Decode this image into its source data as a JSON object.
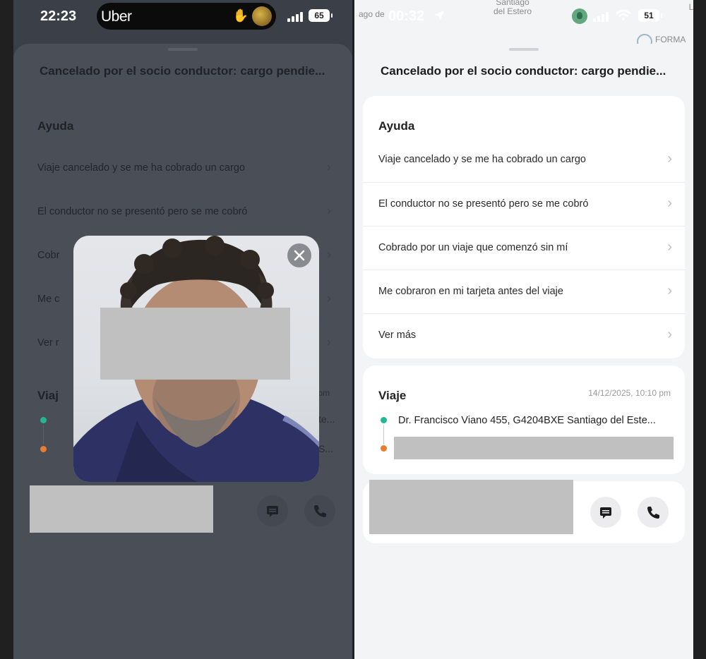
{
  "left_screen": {
    "status": {
      "time": "22:23",
      "battery": "65"
    },
    "live_activity": {
      "brand": "Uber",
      "hand_icon": "hand-icon",
      "thumb_icon": "map-thumb-icon"
    },
    "sheet_title": "Cancelado por el socio conductor: cargo pendie...",
    "help": {
      "heading": "Ayuda",
      "items": [
        "Viaje cancelado y se me ha cobrado un cargo",
        "El conductor no se presentó pero se me cobró",
        "Cobr",
        "Me c",
        "Ver r"
      ]
    },
    "trip": {
      "heading": "Viaj",
      "date": "0 pm",
      "pickup": "te...",
      "dropoff": "S..."
    },
    "photo_popup": {
      "close_icon": "close-icon"
    }
  },
  "right_screen": {
    "status": {
      "time": "00:32",
      "battery": "51"
    },
    "map_labels": {
      "top_center": "Santiago\ndel Estero",
      "top_left": "ago de",
      "top_right": "L",
      "right": "FORMA"
    },
    "sheet_title": "Cancelado por el socio conductor: cargo pendie...",
    "help": {
      "heading": "Ayuda",
      "items": [
        "Viaje cancelado y se me ha cobrado un cargo",
        "El conductor no se presentó pero se me cobró",
        "Cobrado por un viaje que comenzó sin mí",
        "Me cobraron en mi tarjeta antes del viaje",
        "Ver más"
      ]
    },
    "trip": {
      "heading": "Viaje",
      "date": "14/12/2025, 10:10 pm",
      "pickup": "Dr. Francisco Viano 455, G4204BXE Santiago del Este..."
    },
    "driver": {
      "message_icon": "message-icon",
      "phone_icon": "phone-icon"
    }
  },
  "colors": {
    "route_start": "#22b794",
    "route_end": "#ec7a2f",
    "redaction": "#c0c0c0",
    "sheet_light": "#f3f4f6",
    "sheet_dim": "#4a4f57"
  }
}
